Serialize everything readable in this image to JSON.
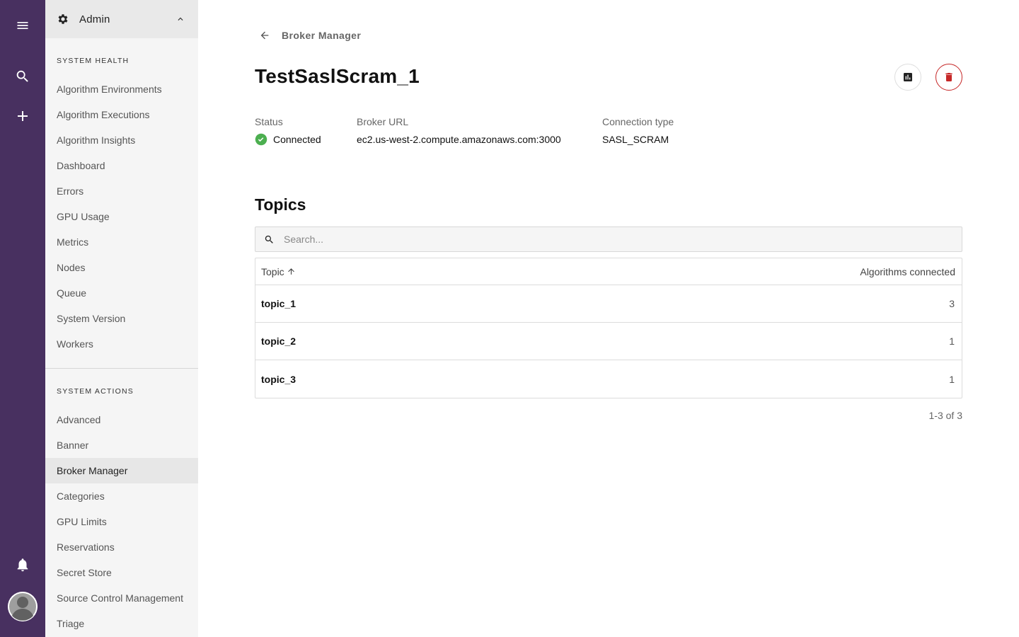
{
  "app": {
    "accent": "#483060",
    "success_color": "#4caf50",
    "danger_color": "#c62828"
  },
  "rail": {
    "icons": [
      "menu-icon",
      "search-icon",
      "add-icon",
      "bell-icon",
      "account-icon"
    ]
  },
  "sidebar": {
    "header": {
      "label": "Admin",
      "icon": "gear-icon"
    },
    "sections": [
      {
        "title": "System Health",
        "items": [
          {
            "label": "Algorithm Environments"
          },
          {
            "label": "Algorithm Executions"
          },
          {
            "label": "Algorithm Insights"
          },
          {
            "label": "Dashboard"
          },
          {
            "label": "Errors"
          },
          {
            "label": "GPU Usage"
          },
          {
            "label": "Metrics"
          },
          {
            "label": "Nodes"
          },
          {
            "label": "Queue"
          },
          {
            "label": "System Version"
          },
          {
            "label": "Workers"
          }
        ]
      },
      {
        "title": "System Actions",
        "items": [
          {
            "label": "Advanced"
          },
          {
            "label": "Banner"
          },
          {
            "label": "Broker Manager",
            "active": true
          },
          {
            "label": "Categories"
          },
          {
            "label": "GPU Limits"
          },
          {
            "label": "Reservations"
          },
          {
            "label": "Secret Store"
          },
          {
            "label": "Source Control Management"
          },
          {
            "label": "Triage"
          }
        ]
      }
    ]
  },
  "breadcrumb": {
    "label": "Broker Manager"
  },
  "page": {
    "title": "TestSaslScram_1",
    "actions": [
      "insights-icon",
      "delete-icon"
    ]
  },
  "details": {
    "status_label": "Status",
    "status_value": "Connected",
    "url_label": "Broker URL",
    "url_value": "ec2.us-west-2.compute.amazonaws.com:3000",
    "conn_label": "Connection type",
    "conn_value": "SASL_SCRAM"
  },
  "topics": {
    "title": "Topics",
    "search_placeholder": "Search...",
    "columns": {
      "topic": "Topic",
      "algorithms": "Algorithms connected"
    },
    "sort": "ascending",
    "rows": [
      {
        "topic": "topic_1",
        "algorithms": "3"
      },
      {
        "topic": "topic_2",
        "algorithms": "1"
      },
      {
        "topic": "topic_3",
        "algorithms": "1"
      }
    ],
    "pagination": "1-3 of 3"
  }
}
